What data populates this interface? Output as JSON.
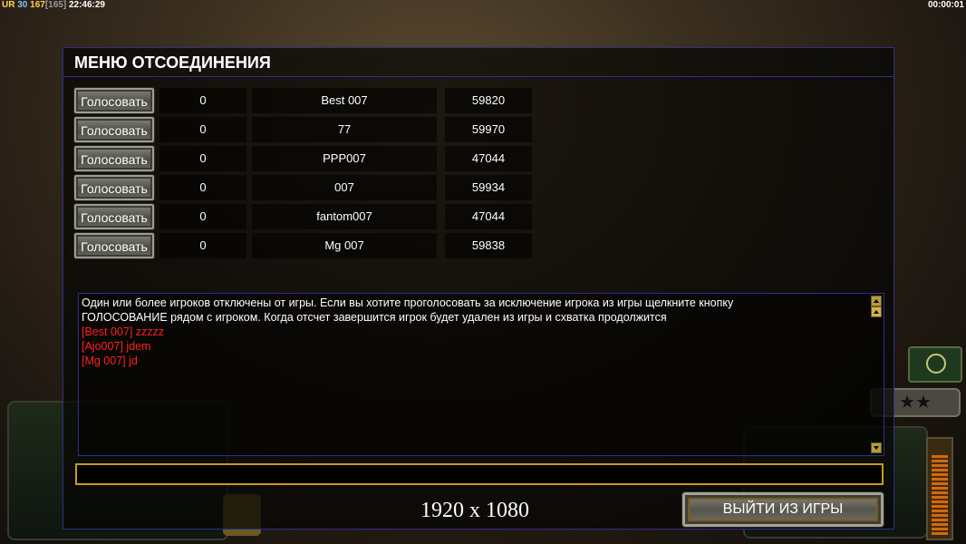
{
  "hud": {
    "ur": "UR",
    "a": "30",
    "b": "167",
    "c": "[165]",
    "clock": "22:46:29",
    "timer": "00:00:01"
  },
  "dialog": {
    "title": "МЕНЮ ОТСОЕДИНЕНИЯ",
    "vote_label": "Голосовать",
    "players": [
      {
        "votes": "0",
        "name": "Best 007",
        "id": "59820"
      },
      {
        "votes": "0",
        "name": "77",
        "id": "59970"
      },
      {
        "votes": "0",
        "name": "PPP007",
        "id": "47044"
      },
      {
        "votes": "0",
        "name": "007",
        "id": "59934"
      },
      {
        "votes": "0",
        "name": "fantom007",
        "id": "47044"
      },
      {
        "votes": "0",
        "name": "Mg 007",
        "id": "59838"
      }
    ],
    "message": {
      "line1": "Один или более игроков отключены от игры. Если вы хотите проголосовать за исключение игрока из игры щелкните кнопку",
      "line2": " ГОЛОСОВАНИЕ рядом с игроком. Когда отсчет завершится игрок будет удален из игры и схватка продолжится",
      "chat": [
        "[Best 007] zzzzz",
        "[Ajo007] jdem",
        "[Mg 007] jd"
      ]
    },
    "chat_input_value": "",
    "exit_label": "ВЫЙТИ ИЗ ИГРЫ"
  },
  "resolution_text": "1920 x 1080",
  "colors": {
    "accent_border": "#2e2e8a",
    "input_border": "#c99a1a",
    "chat_text": "#ff2020"
  }
}
